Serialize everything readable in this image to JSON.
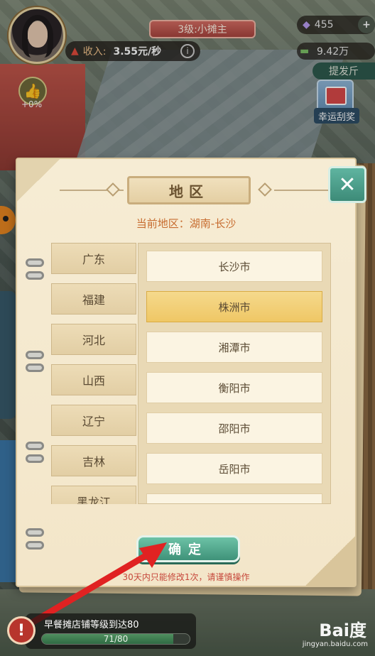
{
  "hud": {
    "level": "3级:小摊主",
    "income_label": "收入:",
    "income_value": "3.55元/秒",
    "info_icon": "i",
    "gems": "455",
    "cash": "9.42万",
    "send_tab": "提发斤",
    "lucky_label": "幸运刮奖",
    "boost_percent": "+0%"
  },
  "dialog": {
    "title": "地区",
    "current_region": "当前地区：湖南-长沙",
    "provinces": [
      "广东",
      "福建",
      "河北",
      "山西",
      "辽宁",
      "吉林",
      "黑龙江"
    ],
    "cities": [
      {
        "name": "长沙市",
        "selected": false
      },
      {
        "name": "株洲市",
        "selected": true
      },
      {
        "name": "湘潭市",
        "selected": false
      },
      {
        "name": "衡阳市",
        "selected": false
      },
      {
        "name": "邵阳市",
        "selected": false
      },
      {
        "name": "岳阳市",
        "selected": false
      },
      {
        "name": "",
        "selected": false
      }
    ],
    "confirm": "确定",
    "notice": "30天内只能修改1次，请谨慎操作",
    "close_icon": "close-x-icon"
  },
  "task": {
    "text": "早餐摊店铺等级到达80",
    "progress": "71/80",
    "progress_fraction": 0.8875,
    "alert_glyph": "!"
  },
  "colors": {
    "accent_teal": "#3d8b78",
    "selected_city": "#efc765",
    "notice_red": "#c6473b",
    "annotation_red": "#e02222"
  },
  "watermark": {
    "brand": "Bai度",
    "url": "jingyan.baidu.com"
  }
}
